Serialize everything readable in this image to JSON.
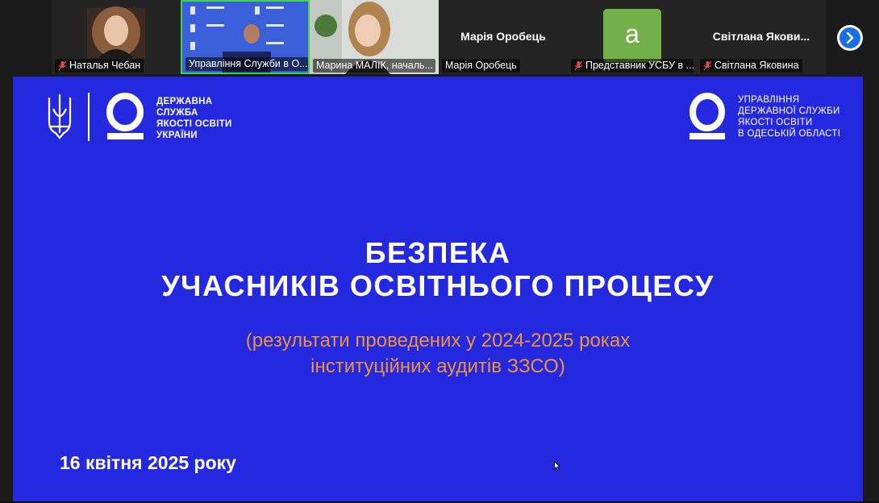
{
  "participants": [
    {
      "name": "Наталья Чебан",
      "muted": true
    },
    {
      "name": "Управління Служби в О...",
      "muted": false,
      "active_speaker": true
    },
    {
      "name": "Марина МАЛІК, началь...",
      "muted": false
    },
    {
      "name": "Марія Оробець",
      "muted": false,
      "display_name": "Марія Оробець"
    },
    {
      "name": "Представник УСБУ в ...",
      "muted": true,
      "avatar_letter": "a"
    },
    {
      "name": "Світлана Яковина",
      "muted": true,
      "display_name": "Світлана Якови..."
    }
  ],
  "colors": {
    "slide_bg": "#2429e0",
    "accent_orange": "#f0923a",
    "speaker_border": "#3ed34f",
    "avatar_green": "#74b04a",
    "next_button": "#1a6fe0"
  },
  "slide": {
    "org_left": [
      "ДЕРЖАВНА",
      "СЛУЖБА",
      "ЯКОСТІ ОСВІТИ",
      "УКРАЇНИ"
    ],
    "org_right": [
      "УПРАВЛІННЯ",
      "ДЕРЖАВНОЇ СЛУЖБИ",
      "ЯКОСТІ ОСВІТИ",
      "В ОДЕСЬКІЙ ОБЛАСТІ"
    ],
    "title_line1": "БЕЗПЕКА",
    "title_line2": "УЧАСНИКІВ ОСВІТНЬОГО ПРОЦЕСУ",
    "subtitle_line1": "(результати проведених у 2024-2025 роках",
    "subtitle_line2": "інституційних аудитів ЗЗСО)",
    "date": "16 квітня 2025 року"
  },
  "icons": {
    "muted_mic": "mic-off-icon",
    "next": "chevron-right-icon",
    "trident": "trident-icon",
    "logo": "quality-service-logo"
  }
}
